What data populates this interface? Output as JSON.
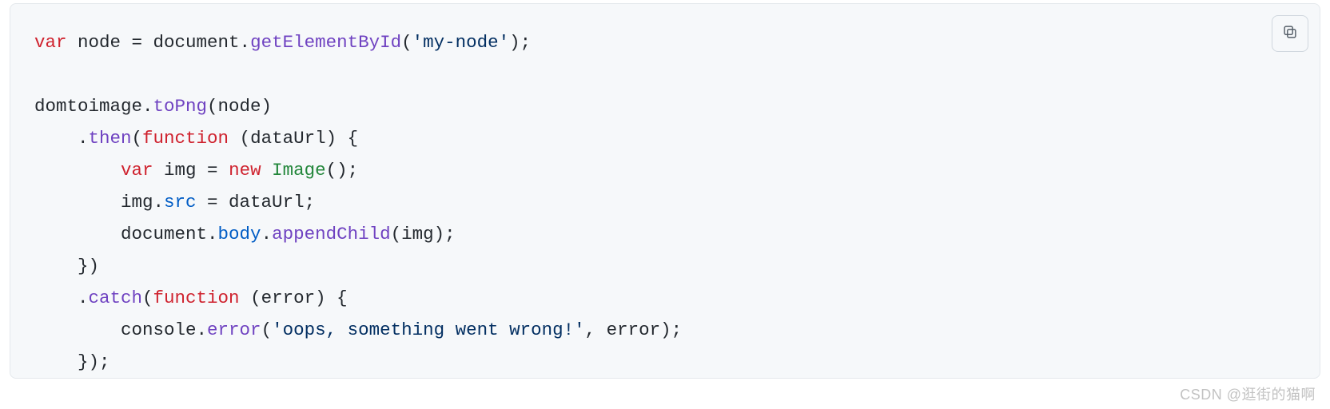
{
  "watermark": "CSDN @逛街的猫啊",
  "code": {
    "tokens": [
      [
        {
          "t": "var ",
          "c": "kw"
        },
        {
          "t": "node = document.",
          "c": "plain"
        },
        {
          "t": "getElementById",
          "c": "fn"
        },
        {
          "t": "(",
          "c": "plain"
        },
        {
          "t": "'my-node'",
          "c": "str"
        },
        {
          "t": ");",
          "c": "plain"
        }
      ],
      [],
      [
        {
          "t": "domtoimage.",
          "c": "plain"
        },
        {
          "t": "toPng",
          "c": "fn"
        },
        {
          "t": "(node)",
          "c": "plain"
        }
      ],
      [
        {
          "t": "    .",
          "c": "plain"
        },
        {
          "t": "then",
          "c": "fn"
        },
        {
          "t": "(",
          "c": "plain"
        },
        {
          "t": "function ",
          "c": "kw"
        },
        {
          "t": "(dataUrl) {",
          "c": "plain"
        }
      ],
      [
        {
          "t": "        ",
          "c": "plain"
        },
        {
          "t": "var ",
          "c": "kw"
        },
        {
          "t": "img = ",
          "c": "plain"
        },
        {
          "t": "new ",
          "c": "kw"
        },
        {
          "t": "Image",
          "c": "cls"
        },
        {
          "t": "();",
          "c": "plain"
        }
      ],
      [
        {
          "t": "        img.",
          "c": "plain"
        },
        {
          "t": "src",
          "c": "fn2"
        },
        {
          "t": " = dataUrl;",
          "c": "plain"
        }
      ],
      [
        {
          "t": "        document.",
          "c": "plain"
        },
        {
          "t": "body",
          "c": "fn2"
        },
        {
          "t": ".",
          "c": "plain"
        },
        {
          "t": "appendChild",
          "c": "fn"
        },
        {
          "t": "(img);",
          "c": "plain"
        }
      ],
      [
        {
          "t": "    })",
          "c": "plain"
        }
      ],
      [
        {
          "t": "    .",
          "c": "plain"
        },
        {
          "t": "catch",
          "c": "fn"
        },
        {
          "t": "(",
          "c": "plain"
        },
        {
          "t": "function ",
          "c": "kw"
        },
        {
          "t": "(error) {",
          "c": "plain"
        }
      ],
      [
        {
          "t": "        console.",
          "c": "plain"
        },
        {
          "t": "error",
          "c": "fn"
        },
        {
          "t": "(",
          "c": "plain"
        },
        {
          "t": "'oops, something went wrong!'",
          "c": "str"
        },
        {
          "t": ", error);",
          "c": "plain"
        }
      ],
      [
        {
          "t": "    });",
          "c": "plain"
        }
      ]
    ]
  }
}
